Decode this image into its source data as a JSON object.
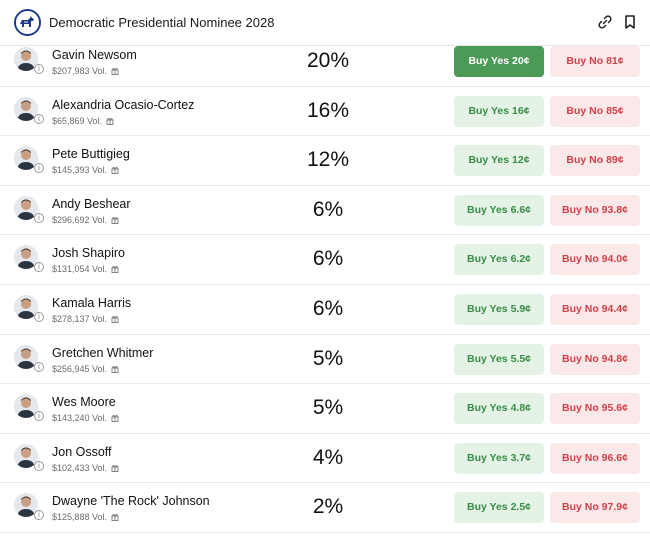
{
  "header": {
    "title": "Democratic Presidential Nominee 2028",
    "logo_icon": "donkey-icon",
    "actions": [
      {
        "icon": "link-icon"
      },
      {
        "icon": "bookmark-icon"
      }
    ]
  },
  "colors": {
    "yes_bg": "#e4f3e6",
    "yes_text": "#3a8c47",
    "yes_active_bg": "#4b9a55",
    "no_bg": "#fbe8e9",
    "no_text": "#d1414a"
  },
  "candidates": [
    {
      "name": "Gavin Newsom",
      "volume": "$207,983 Vol.",
      "percent": "20%",
      "yes": "Buy Yes 20¢",
      "no": "Buy No 81¢",
      "yes_active": true
    },
    {
      "name": "Alexandria Ocasio-Cortez",
      "volume": "$65,869 Vol.",
      "percent": "16%",
      "yes": "Buy Yes 16¢",
      "no": "Buy No 85¢"
    },
    {
      "name": "Pete Buttigieg",
      "volume": "$145,393 Vol.",
      "percent": "12%",
      "yes": "Buy Yes 12¢",
      "no": "Buy No 89¢"
    },
    {
      "name": "Andy Beshear",
      "volume": "$296,692 Vol.",
      "percent": "6%",
      "yes": "Buy Yes 6.6¢",
      "no": "Buy No 93.8¢"
    },
    {
      "name": "Josh Shapiro",
      "volume": "$131,054 Vol.",
      "percent": "6%",
      "yes": "Buy Yes 6.2¢",
      "no": "Buy No 94.0¢"
    },
    {
      "name": "Kamala Harris",
      "volume": "$278,137 Vol.",
      "percent": "6%",
      "yes": "Buy Yes 5.9¢",
      "no": "Buy No 94.4¢"
    },
    {
      "name": "Gretchen Whitmer",
      "volume": "$256,945 Vol.",
      "percent": "5%",
      "yes": "Buy Yes 5.5¢",
      "no": "Buy No 94.8¢"
    },
    {
      "name": "Wes Moore",
      "volume": "$143,240 Vol.",
      "percent": "5%",
      "yes": "Buy Yes 4.8¢",
      "no": "Buy No 95.6¢"
    },
    {
      "name": "Jon Ossoff",
      "volume": "$102,433 Vol.",
      "percent": "4%",
      "yes": "Buy Yes 3.7¢",
      "no": "Buy No 96.6¢"
    },
    {
      "name": "Dwayne 'The Rock' Johnson",
      "volume": "$125,888 Vol.",
      "percent": "2%",
      "yes": "Buy Yes 2.5¢",
      "no": "Buy No 97.9¢"
    }
  ]
}
